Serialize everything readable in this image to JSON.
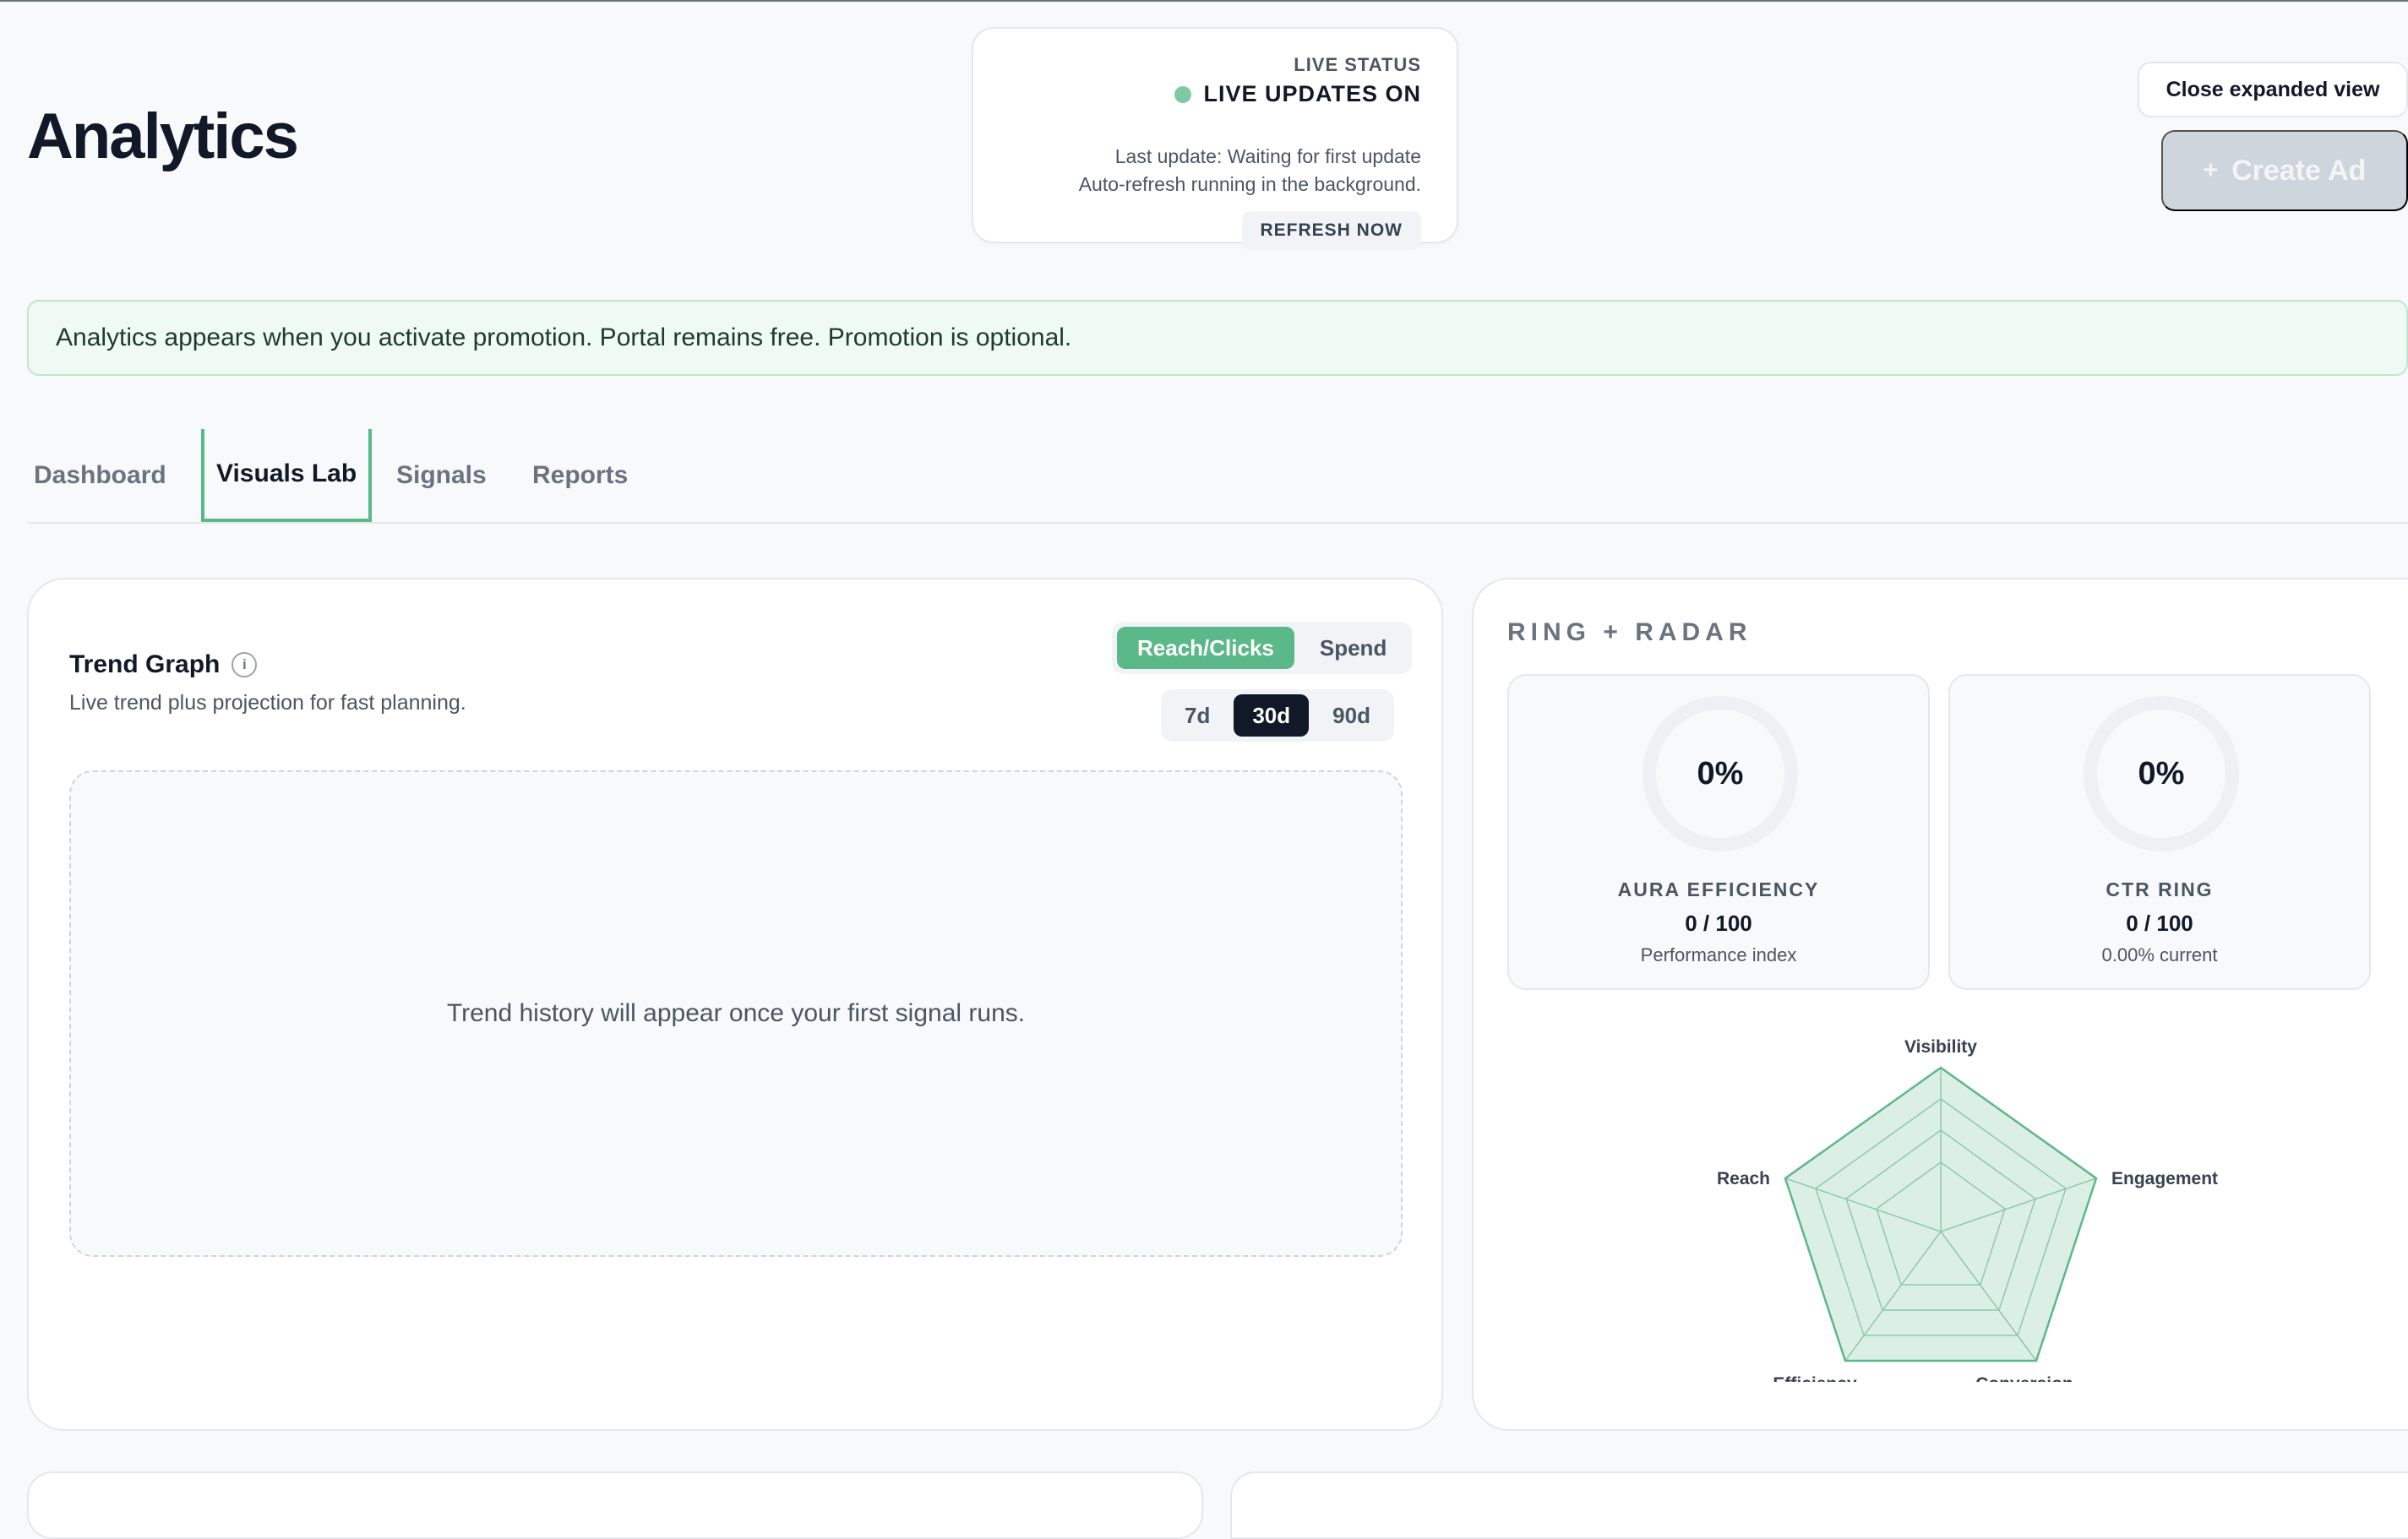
{
  "header": {
    "title": "Analytics"
  },
  "live_status": {
    "label": "LIVE STATUS",
    "state": "LIVE UPDATES ON",
    "last_update": "Last update: Waiting for first update",
    "auto_refresh": "Auto-refresh running in the background.",
    "refresh_button": "REFRESH NOW",
    "dot_color": "#7ec9a2"
  },
  "actions": {
    "close_expanded": "Close expanded view",
    "create_ad_plus": "+",
    "create_ad": "Create Ad"
  },
  "banner": {
    "text": "Analytics appears when you activate promotion. Portal remains free. Promotion is optional."
  },
  "tabs": [
    {
      "label": "Dashboard",
      "active": false
    },
    {
      "label": "Visuals Lab",
      "active": true
    },
    {
      "label": "Signals",
      "active": false
    },
    {
      "label": "Reports",
      "active": false
    }
  ],
  "trend": {
    "title": "Trend Graph",
    "info_icon": "i",
    "subtitle": "Live trend plus projection for fast planning.",
    "metric_options": [
      "Reach/Clicks",
      "Spend"
    ],
    "metric_selected": "Reach/Clicks",
    "range_options": [
      "7d",
      "30d",
      "90d"
    ],
    "range_selected": "30d",
    "empty_message": "Trend history will appear once your first signal runs."
  },
  "ring_radar": {
    "title": "RING + RADAR",
    "rings": [
      {
        "value": "0%",
        "name": "AURA EFFICIENCY",
        "score": "0 / 100",
        "note": "Performance index"
      },
      {
        "value": "0%",
        "name": "CTR RING",
        "score": "0 / 100",
        "note": "0.00% current"
      }
    ],
    "radar_axes": [
      "Visibility",
      "Engagement",
      "Conversion",
      "Efficiency",
      "Reach"
    ],
    "accent_color": "#5bb888"
  }
}
